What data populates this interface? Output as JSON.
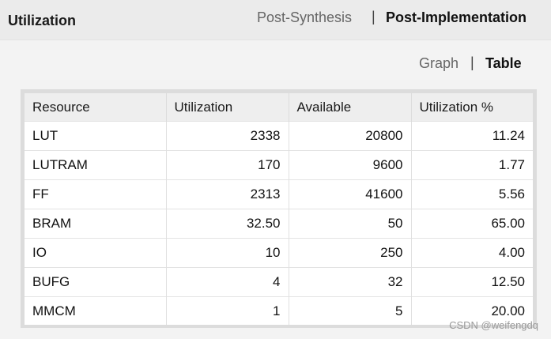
{
  "header": {
    "title": "Utilization",
    "tabs": [
      {
        "label": "Post-Synthesis",
        "active": false
      },
      {
        "label": "Post-Implementation",
        "active": true
      }
    ],
    "separator": "|"
  },
  "view_toggle": {
    "options": [
      {
        "label": "Graph",
        "active": false
      },
      {
        "label": "Table",
        "active": true
      }
    ],
    "separator": "|"
  },
  "table": {
    "columns": [
      "Resource",
      "Utilization",
      "Available",
      "Utilization %"
    ],
    "rows": [
      [
        "LUT",
        "2338",
        "20800",
        "11.24"
      ],
      [
        "LUTRAM",
        "170",
        "9600",
        "1.77"
      ],
      [
        "FF",
        "2313",
        "41600",
        "5.56"
      ],
      [
        "BRAM",
        "32.50",
        "50",
        "65.00"
      ],
      [
        "IO",
        "10",
        "250",
        "4.00"
      ],
      [
        "BUFG",
        "4",
        "32",
        "12.50"
      ],
      [
        "MMCM",
        "1",
        "5",
        "20.00"
      ]
    ]
  },
  "watermark": "CSDN @weifengdq"
}
